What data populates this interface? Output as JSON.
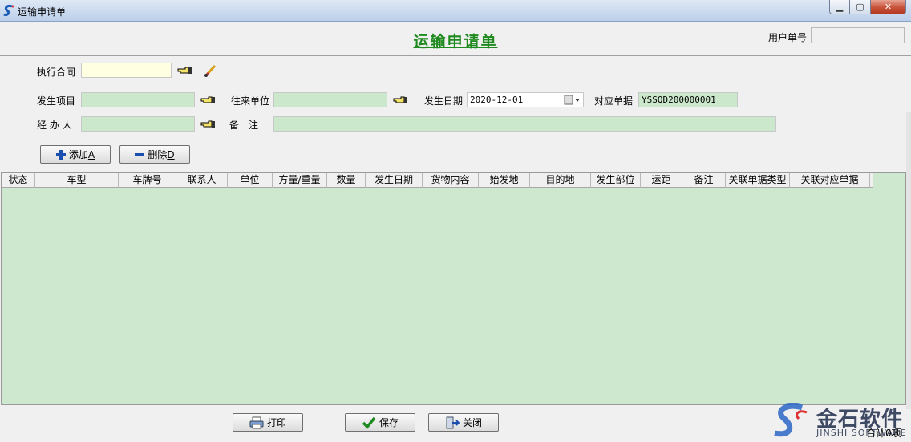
{
  "window": {
    "title": "运输申请单",
    "controls": {
      "minimize": "▁",
      "maximize": "▢",
      "close": "✕"
    }
  },
  "header": {
    "form_title": "运输申请单",
    "user_no_label": "用户单号",
    "user_no_value": ""
  },
  "contract": {
    "label": "执行合同",
    "value": ""
  },
  "fields": {
    "item_label": "发生项目",
    "item_value": "",
    "partner_label": "往来单位",
    "partner_value": "",
    "date_label": "发生日期",
    "date_value": "2020-12-01",
    "ref_label": "对应单据",
    "ref_value": "YSSQD200000001",
    "handler_label": "经 办 人",
    "handler_value": "",
    "remark_label": "备　注",
    "remark_value": ""
  },
  "actions": {
    "add_label": "添加",
    "add_key": "A",
    "delete_label": "删除",
    "delete_key": "D"
  },
  "grid": {
    "columns": [
      "状态",
      "车型",
      "车牌号",
      "联系人",
      "单位",
      "方量/重量",
      "数量",
      "发生日期",
      "货物内容",
      "始发地",
      "目的地",
      "发生部位",
      "运距",
      "备注",
      "关联单据类型",
      "关联对应单据"
    ],
    "rows": []
  },
  "footer": {
    "print_label": "打印",
    "save_label": "保存",
    "close_label": "关闭",
    "total_text": "合计0项"
  },
  "watermark": {
    "brand_cn": "金石软件",
    "brand_en": "JINSHI SOFTWARE"
  },
  "colors": {
    "form_title": "#1f8a1f",
    "grid_background": "#cde8cf",
    "input_yellow": "#ffffe1",
    "input_green": "#cce8cc"
  }
}
